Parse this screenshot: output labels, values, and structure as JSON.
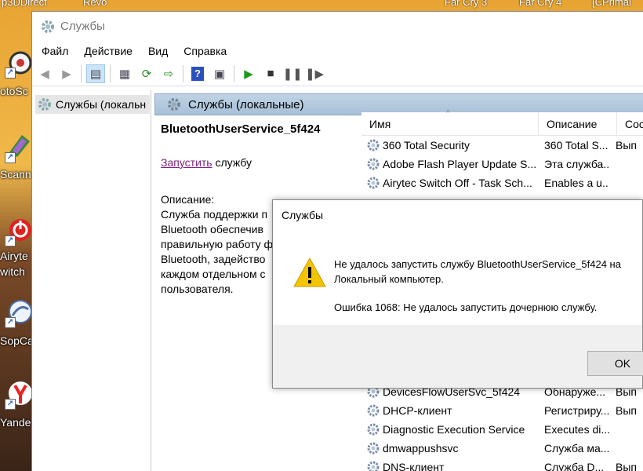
{
  "desktop": {
    "top_labels": [
      "p3DDirect",
      "Revo",
      "Far Cry 3",
      "Far Cry 4",
      "[CPrimal"
    ],
    "icons": [
      {
        "label": "otoSc",
        "icon": "photoscape-icon"
      },
      {
        "label": "Scann",
        "icon": "scanner-icon"
      },
      {
        "label": "Airyte",
        "label2": "witch",
        "icon": "airytec-switch-icon"
      },
      {
        "label": "SopCa",
        "icon": "sopcast-icon"
      },
      {
        "label": "Yande",
        "icon": "yandex-icon"
      }
    ]
  },
  "window": {
    "title": "Службы",
    "menu": [
      "Файл",
      "Действие",
      "Вид",
      "Справка"
    ],
    "tree_item": "Службы (локальн",
    "pane_title": "Службы (локальные)"
  },
  "detail": {
    "service_name": "BluetoothUserService_5f424",
    "start_link": "Запустить",
    "start_suffix": " службу",
    "description_label": "Описание:",
    "description_lines": [
      "Служба поддержки п",
      "Bluetooth обеспечив",
      "правильную работу ф",
      "Bluetooth, задейство",
      "каждом отдельном с",
      "пользователя."
    ]
  },
  "list": {
    "columns": [
      "Имя",
      "Описание",
      "Сост"
    ],
    "rows_top": [
      {
        "name": "360 Total Security",
        "desc": "360 Total S...",
        "state": "Вып"
      },
      {
        "name": "Adobe Flash Player Update S...",
        "desc": "Эта служба...",
        "state": ""
      },
      {
        "name": "Airytec Switch Off - Task Sch...",
        "desc": "Enables a u...",
        "state": ""
      }
    ],
    "rows_bottom": [
      {
        "name": "DevicesFlowUserSvc_5f424",
        "desc": "Обнаруже...",
        "state": "Вып"
      },
      {
        "name": "DHCP-клиент",
        "desc": "Регистриру...",
        "state": "Вып"
      },
      {
        "name": "Diagnostic Execution Service",
        "desc": "Executes di...",
        "state": ""
      },
      {
        "name": "dmwappushsvc",
        "desc": "Служба ма...",
        "state": ""
      },
      {
        "name": "DNS-клиент",
        "desc": "Служба D...",
        "state": "Вып"
      }
    ]
  },
  "dialog": {
    "title": "Службы",
    "message_line1": "Не удалось запустить службу BluetoothUserService_5f424 на",
    "message_line2": "Локальный компьютер.",
    "error": "Ошибка 1068: Не удалось запустить дочернюю службу.",
    "ok_label": "OK"
  },
  "colors": {
    "accent": "#2a5fbf",
    "pane_header": "#b4c9dd",
    "warning": "#f5c400",
    "link": "#7a1f7a"
  }
}
